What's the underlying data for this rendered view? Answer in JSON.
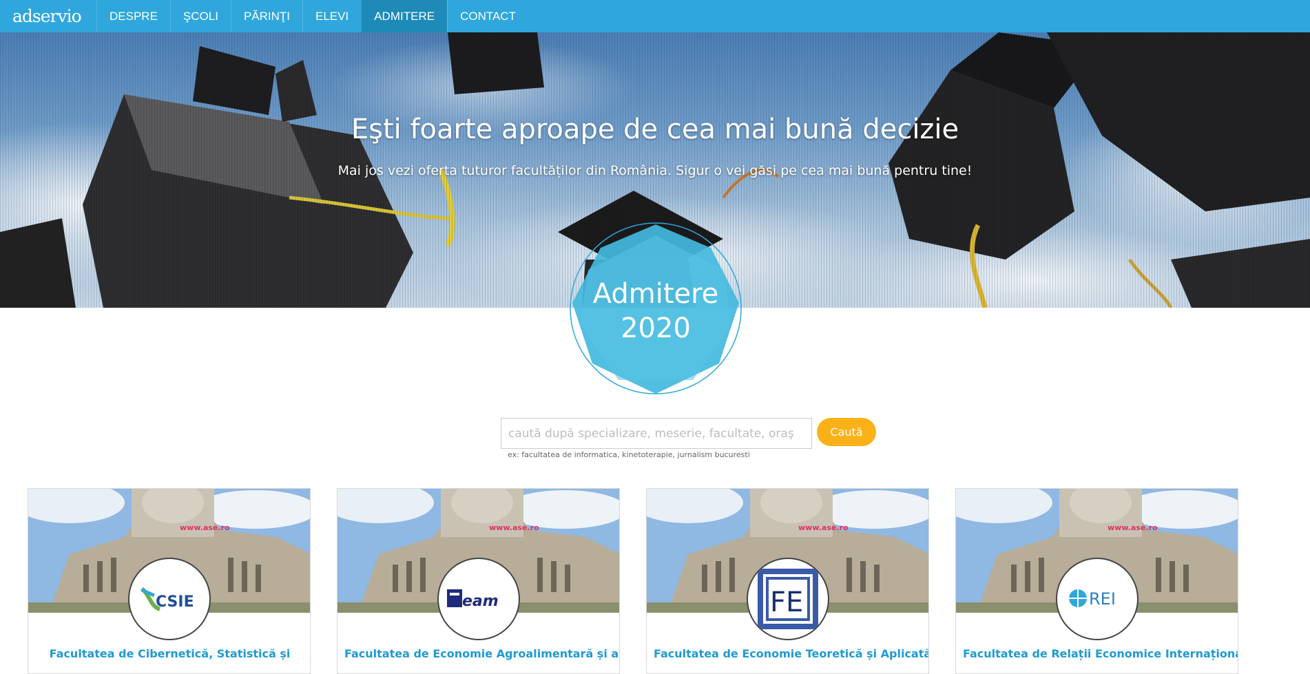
{
  "navbar": {
    "logo": "adservio",
    "items": [
      {
        "label": "DESPRE",
        "active": false
      },
      {
        "label": "ŞCOLI",
        "active": false
      },
      {
        "label": "PĂRINŢI",
        "active": false
      },
      {
        "label": "ELEVI",
        "active": false
      },
      {
        "label": "ADMITERE",
        "active": true
      },
      {
        "label": "CONTACT",
        "active": false
      }
    ]
  },
  "hero": {
    "title": "Eşti foarte aproape de cea mai bună decizie",
    "subtitle": "Mai jos vezi oferta tuturor facultăților din România. Sigur o vei găsi pe cea mai bună pentru tine!"
  },
  "badge": {
    "title": "Admitere",
    "year": "2020"
  },
  "search": {
    "placeholder": "caută după specializare, meserie, facultate, oraş",
    "value": "",
    "button_label": "Caută",
    "hint": "ex: facultatea de informatica, kinetoterapie, jurnalism bucuresti"
  },
  "cards": [
    {
      "title": "Facultatea de Cibernetică, Statistică și",
      "logo": "CSIE"
    },
    {
      "title": "Facultatea de Economie Agroalimentară și a",
      "logo": "eam"
    },
    {
      "title": "Facultatea de Economie Teoretică și Aplicată",
      "logo": "FE"
    },
    {
      "title": "Facultatea de Relații Economice Internaționale",
      "logo": "REI"
    }
  ],
  "colors": {
    "navbar": "#2fa7dc",
    "nav_active": "#1d8ab8",
    "badge": "#43b8de",
    "search_button": "#fbb117",
    "card_title": "#1e9ad3"
  }
}
